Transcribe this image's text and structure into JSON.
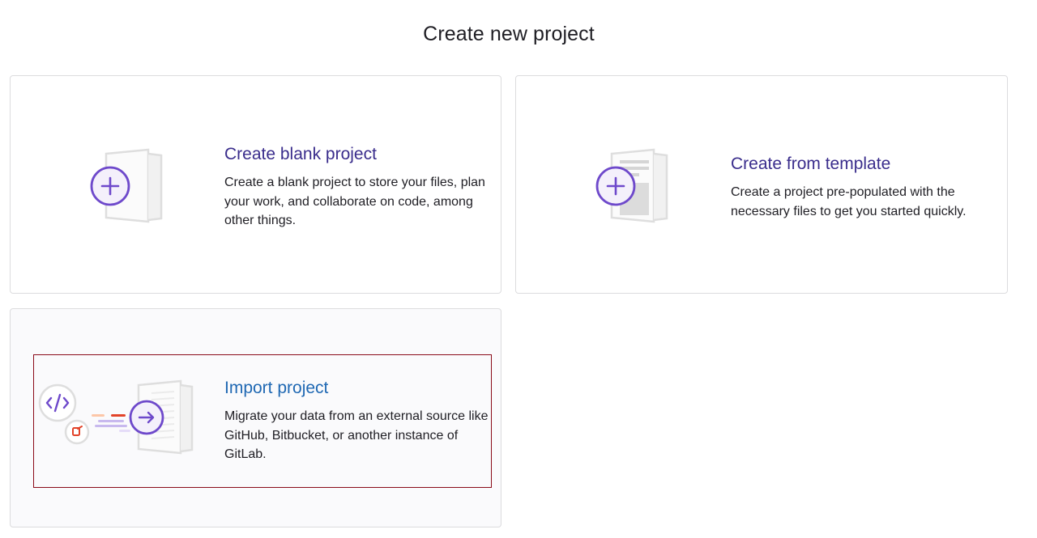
{
  "page": {
    "title": "Create new project"
  },
  "cards": {
    "blank": {
      "title": "Create blank project",
      "description": "Create a blank project to store your files, plan your work, and collaborate on code, among other things.",
      "icon": "new-blank-project-illustration-icon"
    },
    "template": {
      "title": "Create from template",
      "description": "Create a project pre-populated with the necessary files to get you started quickly.",
      "icon": "template-project-illustration-icon"
    },
    "import": {
      "title": "Import project",
      "description": "Migrate your data from an external source like GitHub, Bitbucket, or another instance of GitLab.",
      "icon": "import-project-illustration-icon"
    }
  },
  "colors": {
    "accent_purple": "#6e49cb",
    "title_purple": "#3a2d8c",
    "link_blue": "#1f68b3",
    "focus_border": "#8a0a18",
    "orange": "#e24329"
  }
}
